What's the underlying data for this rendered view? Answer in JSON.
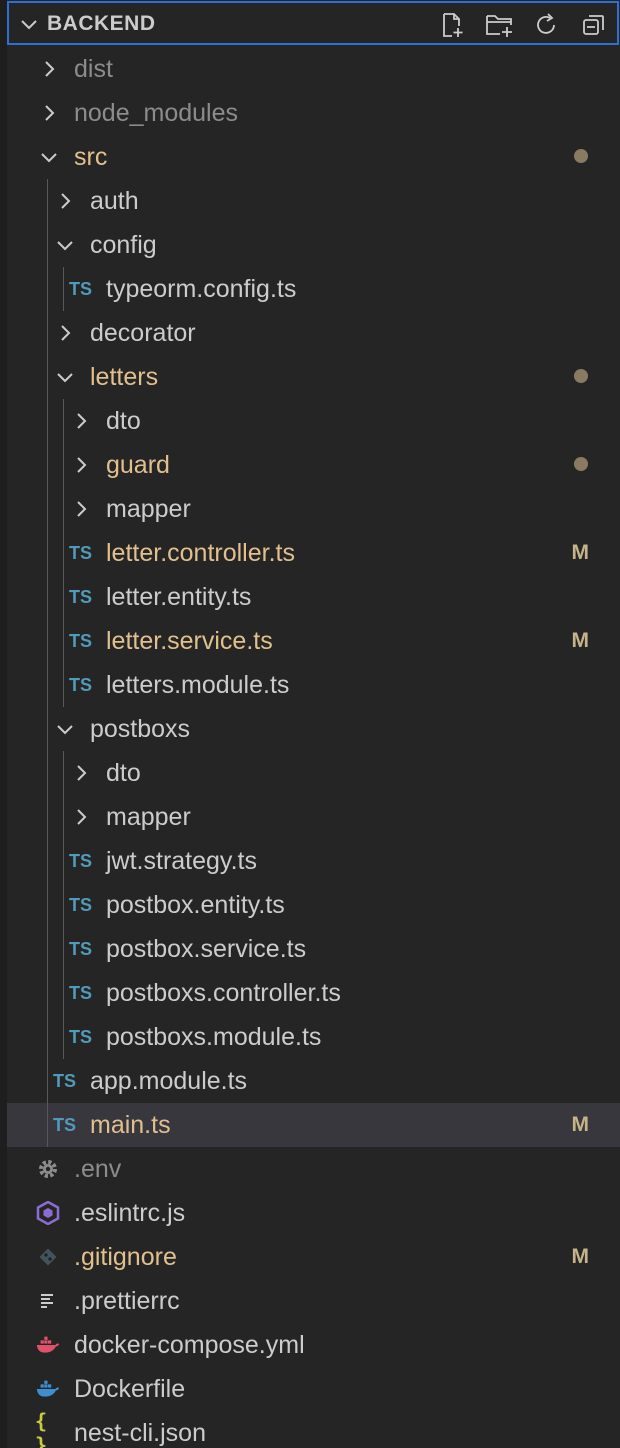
{
  "explorer": {
    "title": "BACKEND",
    "actions": [
      "new-file-icon",
      "new-folder-icon",
      "refresh-icon",
      "collapse-all-icon"
    ]
  },
  "tree": [
    {
      "name": "dist",
      "kind": "folder",
      "expanded": false,
      "depth": 0,
      "state": "ignored"
    },
    {
      "name": "node_modules",
      "kind": "folder",
      "expanded": false,
      "depth": 0,
      "state": "ignored"
    },
    {
      "name": "src",
      "kind": "folder",
      "expanded": true,
      "depth": 0,
      "state": "modified",
      "badge": "dot"
    },
    {
      "name": "auth",
      "kind": "folder",
      "expanded": false,
      "depth": 1,
      "state": "normal"
    },
    {
      "name": "config",
      "kind": "folder",
      "expanded": true,
      "depth": 1,
      "state": "normal"
    },
    {
      "name": "typeorm.config.ts",
      "kind": "ts",
      "depth": 2,
      "state": "normal"
    },
    {
      "name": "decorator",
      "kind": "folder",
      "expanded": false,
      "depth": 1,
      "state": "normal"
    },
    {
      "name": "letters",
      "kind": "folder",
      "expanded": true,
      "depth": 1,
      "state": "modified",
      "badge": "dot"
    },
    {
      "name": "dto",
      "kind": "folder",
      "expanded": false,
      "depth": 2,
      "state": "normal"
    },
    {
      "name": "guard",
      "kind": "folder",
      "expanded": false,
      "depth": 2,
      "state": "modified",
      "badge": "dot"
    },
    {
      "name": "mapper",
      "kind": "folder",
      "expanded": false,
      "depth": 2,
      "state": "normal"
    },
    {
      "name": "letter.controller.ts",
      "kind": "ts",
      "depth": 2,
      "state": "modified",
      "badge": "M"
    },
    {
      "name": "letter.entity.ts",
      "kind": "ts",
      "depth": 2,
      "state": "normal"
    },
    {
      "name": "letter.service.ts",
      "kind": "ts",
      "depth": 2,
      "state": "modified",
      "badge": "M"
    },
    {
      "name": "letters.module.ts",
      "kind": "ts",
      "depth": 2,
      "state": "normal"
    },
    {
      "name": "postboxs",
      "kind": "folder",
      "expanded": true,
      "depth": 1,
      "state": "normal"
    },
    {
      "name": "dto",
      "kind": "folder",
      "expanded": false,
      "depth": 2,
      "state": "normal"
    },
    {
      "name": "mapper",
      "kind": "folder",
      "expanded": false,
      "depth": 2,
      "state": "normal"
    },
    {
      "name": "jwt.strategy.ts",
      "kind": "ts",
      "depth": 2,
      "state": "normal"
    },
    {
      "name": "postbox.entity.ts",
      "kind": "ts",
      "depth": 2,
      "state": "normal"
    },
    {
      "name": "postbox.service.ts",
      "kind": "ts",
      "depth": 2,
      "state": "normal"
    },
    {
      "name": "postboxs.controller.ts",
      "kind": "ts",
      "depth": 2,
      "state": "normal"
    },
    {
      "name": "postboxs.module.ts",
      "kind": "ts",
      "depth": 2,
      "state": "normal"
    },
    {
      "name": "app.module.ts",
      "kind": "ts",
      "depth": 1,
      "state": "normal"
    },
    {
      "name": "main.ts",
      "kind": "ts",
      "depth": 1,
      "state": "modified",
      "badge": "M",
      "selected": true
    },
    {
      "name": ".env",
      "kind": "gear",
      "depth": 0,
      "state": "ignored"
    },
    {
      "name": ".eslintrc.js",
      "kind": "eslint",
      "depth": 0,
      "state": "normal"
    },
    {
      "name": ".gitignore",
      "kind": "git",
      "depth": 0,
      "state": "modified",
      "badge": "M"
    },
    {
      "name": ".prettierrc",
      "kind": "lines",
      "depth": 0,
      "state": "normal"
    },
    {
      "name": "docker-compose.yml",
      "kind": "docker-red",
      "depth": 0,
      "state": "normal"
    },
    {
      "name": "Dockerfile",
      "kind": "docker-blue",
      "depth": 0,
      "state": "normal"
    },
    {
      "name": "nest-cli.json",
      "kind": "json",
      "depth": 0,
      "state": "normal"
    }
  ],
  "labels": {
    "ts_icon": "TS",
    "json_icon": "{ }"
  },
  "colors": {
    "accent": "#2f6fd0",
    "modified": "#e2c08d",
    "badge": "#c5b389",
    "dot": "#8a7a62",
    "ts": "#519aba"
  }
}
